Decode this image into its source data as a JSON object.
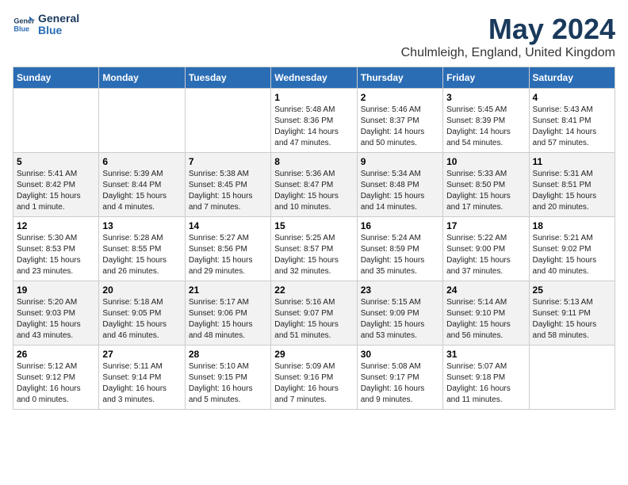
{
  "header": {
    "logo_line1": "General",
    "logo_line2": "Blue",
    "title": "May 2024",
    "subtitle": "Chulmleigh, England, United Kingdom"
  },
  "days_of_week": [
    "Sunday",
    "Monday",
    "Tuesday",
    "Wednesday",
    "Thursday",
    "Friday",
    "Saturday"
  ],
  "weeks": [
    {
      "days": [
        {
          "number": "",
          "info": ""
        },
        {
          "number": "",
          "info": ""
        },
        {
          "number": "",
          "info": ""
        },
        {
          "number": "1",
          "info": "Sunrise: 5:48 AM\nSunset: 8:36 PM\nDaylight: 14 hours\nand 47 minutes."
        },
        {
          "number": "2",
          "info": "Sunrise: 5:46 AM\nSunset: 8:37 PM\nDaylight: 14 hours\nand 50 minutes."
        },
        {
          "number": "3",
          "info": "Sunrise: 5:45 AM\nSunset: 8:39 PM\nDaylight: 14 hours\nand 54 minutes."
        },
        {
          "number": "4",
          "info": "Sunrise: 5:43 AM\nSunset: 8:41 PM\nDaylight: 14 hours\nand 57 minutes."
        }
      ]
    },
    {
      "days": [
        {
          "number": "5",
          "info": "Sunrise: 5:41 AM\nSunset: 8:42 PM\nDaylight: 15 hours\nand 1 minute."
        },
        {
          "number": "6",
          "info": "Sunrise: 5:39 AM\nSunset: 8:44 PM\nDaylight: 15 hours\nand 4 minutes."
        },
        {
          "number": "7",
          "info": "Sunrise: 5:38 AM\nSunset: 8:45 PM\nDaylight: 15 hours\nand 7 minutes."
        },
        {
          "number": "8",
          "info": "Sunrise: 5:36 AM\nSunset: 8:47 PM\nDaylight: 15 hours\nand 10 minutes."
        },
        {
          "number": "9",
          "info": "Sunrise: 5:34 AM\nSunset: 8:48 PM\nDaylight: 15 hours\nand 14 minutes."
        },
        {
          "number": "10",
          "info": "Sunrise: 5:33 AM\nSunset: 8:50 PM\nDaylight: 15 hours\nand 17 minutes."
        },
        {
          "number": "11",
          "info": "Sunrise: 5:31 AM\nSunset: 8:51 PM\nDaylight: 15 hours\nand 20 minutes."
        }
      ]
    },
    {
      "days": [
        {
          "number": "12",
          "info": "Sunrise: 5:30 AM\nSunset: 8:53 PM\nDaylight: 15 hours\nand 23 minutes."
        },
        {
          "number": "13",
          "info": "Sunrise: 5:28 AM\nSunset: 8:55 PM\nDaylight: 15 hours\nand 26 minutes."
        },
        {
          "number": "14",
          "info": "Sunrise: 5:27 AM\nSunset: 8:56 PM\nDaylight: 15 hours\nand 29 minutes."
        },
        {
          "number": "15",
          "info": "Sunrise: 5:25 AM\nSunset: 8:57 PM\nDaylight: 15 hours\nand 32 minutes."
        },
        {
          "number": "16",
          "info": "Sunrise: 5:24 AM\nSunset: 8:59 PM\nDaylight: 15 hours\nand 35 minutes."
        },
        {
          "number": "17",
          "info": "Sunrise: 5:22 AM\nSunset: 9:00 PM\nDaylight: 15 hours\nand 37 minutes."
        },
        {
          "number": "18",
          "info": "Sunrise: 5:21 AM\nSunset: 9:02 PM\nDaylight: 15 hours\nand 40 minutes."
        }
      ]
    },
    {
      "days": [
        {
          "number": "19",
          "info": "Sunrise: 5:20 AM\nSunset: 9:03 PM\nDaylight: 15 hours\nand 43 minutes."
        },
        {
          "number": "20",
          "info": "Sunrise: 5:18 AM\nSunset: 9:05 PM\nDaylight: 15 hours\nand 46 minutes."
        },
        {
          "number": "21",
          "info": "Sunrise: 5:17 AM\nSunset: 9:06 PM\nDaylight: 15 hours\nand 48 minutes."
        },
        {
          "number": "22",
          "info": "Sunrise: 5:16 AM\nSunset: 9:07 PM\nDaylight: 15 hours\nand 51 minutes."
        },
        {
          "number": "23",
          "info": "Sunrise: 5:15 AM\nSunset: 9:09 PM\nDaylight: 15 hours\nand 53 minutes."
        },
        {
          "number": "24",
          "info": "Sunrise: 5:14 AM\nSunset: 9:10 PM\nDaylight: 15 hours\nand 56 minutes."
        },
        {
          "number": "25",
          "info": "Sunrise: 5:13 AM\nSunset: 9:11 PM\nDaylight: 15 hours\nand 58 minutes."
        }
      ]
    },
    {
      "days": [
        {
          "number": "26",
          "info": "Sunrise: 5:12 AM\nSunset: 9:12 PM\nDaylight: 16 hours\nand 0 minutes."
        },
        {
          "number": "27",
          "info": "Sunrise: 5:11 AM\nSunset: 9:14 PM\nDaylight: 16 hours\nand 3 minutes."
        },
        {
          "number": "28",
          "info": "Sunrise: 5:10 AM\nSunset: 9:15 PM\nDaylight: 16 hours\nand 5 minutes."
        },
        {
          "number": "29",
          "info": "Sunrise: 5:09 AM\nSunset: 9:16 PM\nDaylight: 16 hours\nand 7 minutes."
        },
        {
          "number": "30",
          "info": "Sunrise: 5:08 AM\nSunset: 9:17 PM\nDaylight: 16 hours\nand 9 minutes."
        },
        {
          "number": "31",
          "info": "Sunrise: 5:07 AM\nSunset: 9:18 PM\nDaylight: 16 hours\nand 11 minutes."
        },
        {
          "number": "",
          "info": ""
        }
      ]
    }
  ]
}
